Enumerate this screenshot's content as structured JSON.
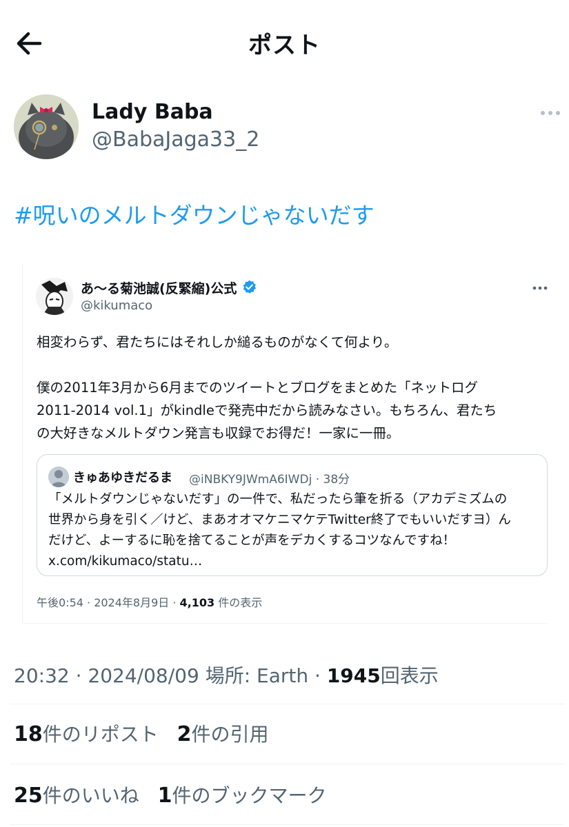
{
  "header": {
    "title": "ポスト"
  },
  "post": {
    "author_name": "Lady Baba",
    "author_handle": "@BabaJaga33_2",
    "text": "#呪いのメルトダウンじゃないだす"
  },
  "quoted": {
    "author_name": "あ〜る菊池誠(反緊縮)公式",
    "author_handle": "@kikumaco",
    "lines": [
      "相変わらず、君たちにはそれしか縋るものがなくて何より。",
      "",
      "僕の2011年3月から6月までのツイートとブログをまとめた「ネットログ",
      "2011-2014 vol.1」がkindleで発売中だから読みなさい。もちろん、君たち",
      "の大好きなメルトダウン発言も収録でお得だ！一家に一冊。"
    ],
    "inner": {
      "author_name": "きゅあゆきだるま",
      "author_handle_time": "@iNBKY9JWmA6IWDj · 38分",
      "lines": [
        "「メルトダウンじゃないだす」の一件で、私だったら筆を折る（アカデミズムの",
        "世界から身を引く／けど、まあオオマケニマケテTwitter終了でもいいだすヨ）ん",
        "だけど、よーするに恥を捨てることが声をデカくするコツなんですね！",
        "x.com/kikumaco/statu…"
      ]
    },
    "meta_time": "午後0:54 · 2024年8月9日 · ",
    "views_count": "4,103",
    "views_label": " 件の表示"
  },
  "meta": {
    "time": "20:32 · 2024/08/09 ",
    "location": "場所: Earth · ",
    "views_count": "1945",
    "views_label": "回表示"
  },
  "stats": {
    "reposts_count": "18",
    "reposts_label": "件のリポスト",
    "quotes_count": "2",
    "quotes_label": "件の引用",
    "likes_count": "25",
    "likes_label": "件のいいね",
    "bookmarks_count": "1",
    "bookmarks_label": "件のブックマーク"
  },
  "colors": {
    "link": "#1d9bf0",
    "secondary_text": "#536471",
    "primary_text": "#0f1419",
    "verified": "#1d9bf0"
  }
}
